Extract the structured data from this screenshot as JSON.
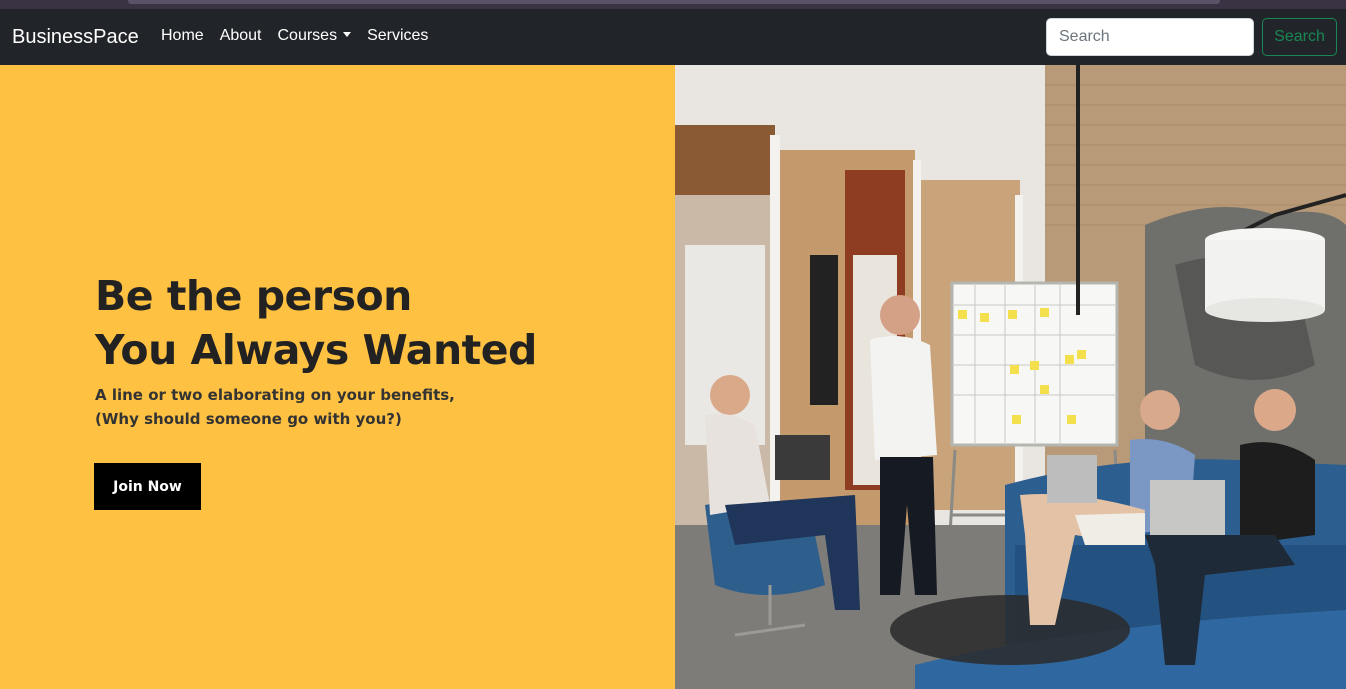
{
  "navbar": {
    "brand": "BusinessPace",
    "links": [
      {
        "label": "Home"
      },
      {
        "label": "About"
      },
      {
        "label": "Courses"
      },
      {
        "label": "Services"
      }
    ],
    "search": {
      "placeholder": "Search",
      "value": "",
      "button_label": "Search"
    }
  },
  "hero": {
    "title_line1": "Be the person",
    "title_line2": "You Always Wanted",
    "subtitle_line1": "A line or two elaborating on your benefits,",
    "subtitle_line2": "(Why should someone go with you?)",
    "cta_label": "Join Now",
    "background_color": "#fec142"
  },
  "colors": {
    "navbar_bg": "#212529",
    "search_button": "#198754"
  },
  "icons": {
    "courses_dropdown": "caret-down-icon"
  }
}
